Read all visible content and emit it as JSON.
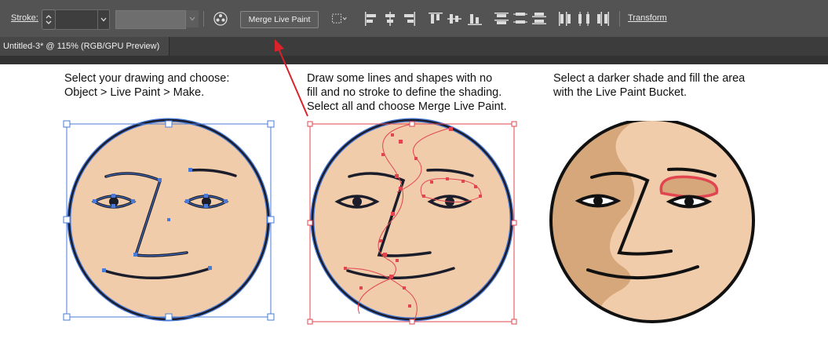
{
  "toolbar": {
    "stroke_label": "Stroke:",
    "stroke_value": "",
    "merge_label": "Merge Live Paint",
    "transform_label": "Transform",
    "icons": {
      "stepper": "stepper-icon",
      "recolor": "recolor-artwork-icon",
      "select_similar": "select-similar-icon",
      "align_left": "align-left-icon",
      "align_hcenter": "align-horizontal-center-icon",
      "align_right": "align-right-icon",
      "align_top": "align-top-icon",
      "align_vcenter": "align-vertical-center-icon",
      "align_bottom": "align-bottom-icon",
      "dist_top": "distribute-top-icon",
      "dist_vcenter": "distribute-vertical-center-icon",
      "dist_bottom": "distribute-bottom-icon",
      "dist_left": "distribute-left-icon",
      "dist_hcenter": "distribute-horizontal-center-icon",
      "dist_right": "distribute-right-icon"
    }
  },
  "document_tab": {
    "title": "Untitled-3* @ 115% (RGB/GPU Preview)"
  },
  "captions": {
    "step1": [
      "Select your drawing and choose:",
      "Object > Live Paint > Make."
    ],
    "step2": [
      "Draw some lines and shapes with no",
      "fill and no stroke to define the shading.",
      "Select all and choose Merge Live Paint."
    ],
    "step3": [
      "Select a darker shade and fill the area",
      "with the Live Paint Bucket."
    ]
  },
  "colors": {
    "toolbar_bg": "#535353",
    "tab_bg": "#474747",
    "skin": "#f0ccab",
    "shade": "#d5a77b",
    "outline": "#1b1d2a",
    "selection_blue": "#4a7bd9",
    "selection_red": "#e2454f",
    "annotation_arrow": "#d9232b"
  }
}
